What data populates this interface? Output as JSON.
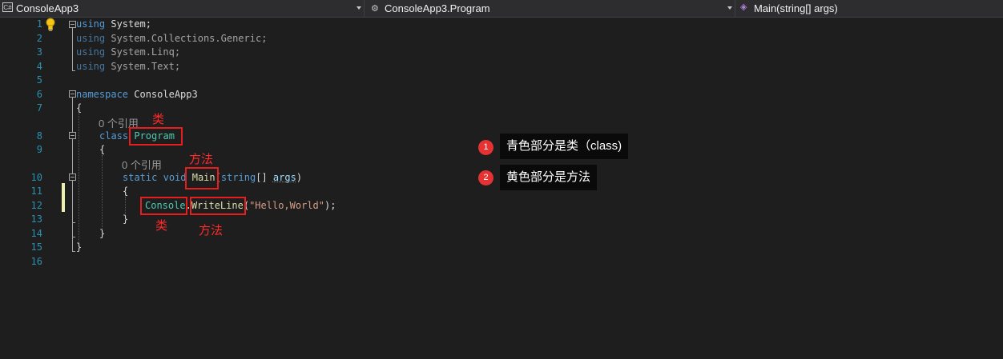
{
  "navbar": {
    "project": "ConsoleApp3",
    "type": "ConsoleApp3.Program",
    "member": "Main(string[] args)",
    "project_icon_text": "C#"
  },
  "gutter": {
    "line_numbers": [
      "1",
      "2",
      "3",
      "4",
      "5",
      "6",
      "7",
      "8",
      "9",
      "10",
      "11",
      "12",
      "13",
      "14",
      "15",
      "16"
    ]
  },
  "code": {
    "l1_kw": "using",
    "l1_rest": " System;",
    "l2_kw": "using",
    "l2_rest": " System.Collections.Generic;",
    "l3_kw": "using",
    "l3_rest": " System.Linq;",
    "l4_kw": "using",
    "l4_rest": " System.Text;",
    "l6_kw": "namespace",
    "l6_rest": " ConsoleApp3",
    "l7": "{",
    "lens1": "0 个引用",
    "l8_kw": "class",
    "l8_type": "Program",
    "l9": "{",
    "lens2": "0 个引用",
    "l10_kw1": "static",
    "l10_kw2": "void",
    "l10_fn": "Main",
    "l10_p1": "(",
    "l10_kw3": "string",
    "l10_p2": "[] ",
    "l10_param": "args",
    "l10_p3": ")",
    "l11": "{",
    "l12_type": "Console",
    "l12_dot": ".",
    "l12_fn": "WriteLine",
    "l12_p1": "(",
    "l12_str": "\"Hello,World\"",
    "l12_p2": ");",
    "l13": "}",
    "l14": "}",
    "l15": "}"
  },
  "annotations": {
    "class_label_1": "类",
    "method_label_1": "方法",
    "class_label_2": "类",
    "method_label_2": "方法",
    "callout1_num": "1",
    "callout1_text": "青色部分是类（class)",
    "callout2_num": "2",
    "callout2_text": "黄色部分是方法"
  },
  "colors": {
    "keyword": "#569cd6",
    "type": "#4ec9b0",
    "method": "#dcdcaa",
    "string": "#d69d85",
    "line_number": "#2b91af",
    "highlight_box": "#e61e1e"
  }
}
